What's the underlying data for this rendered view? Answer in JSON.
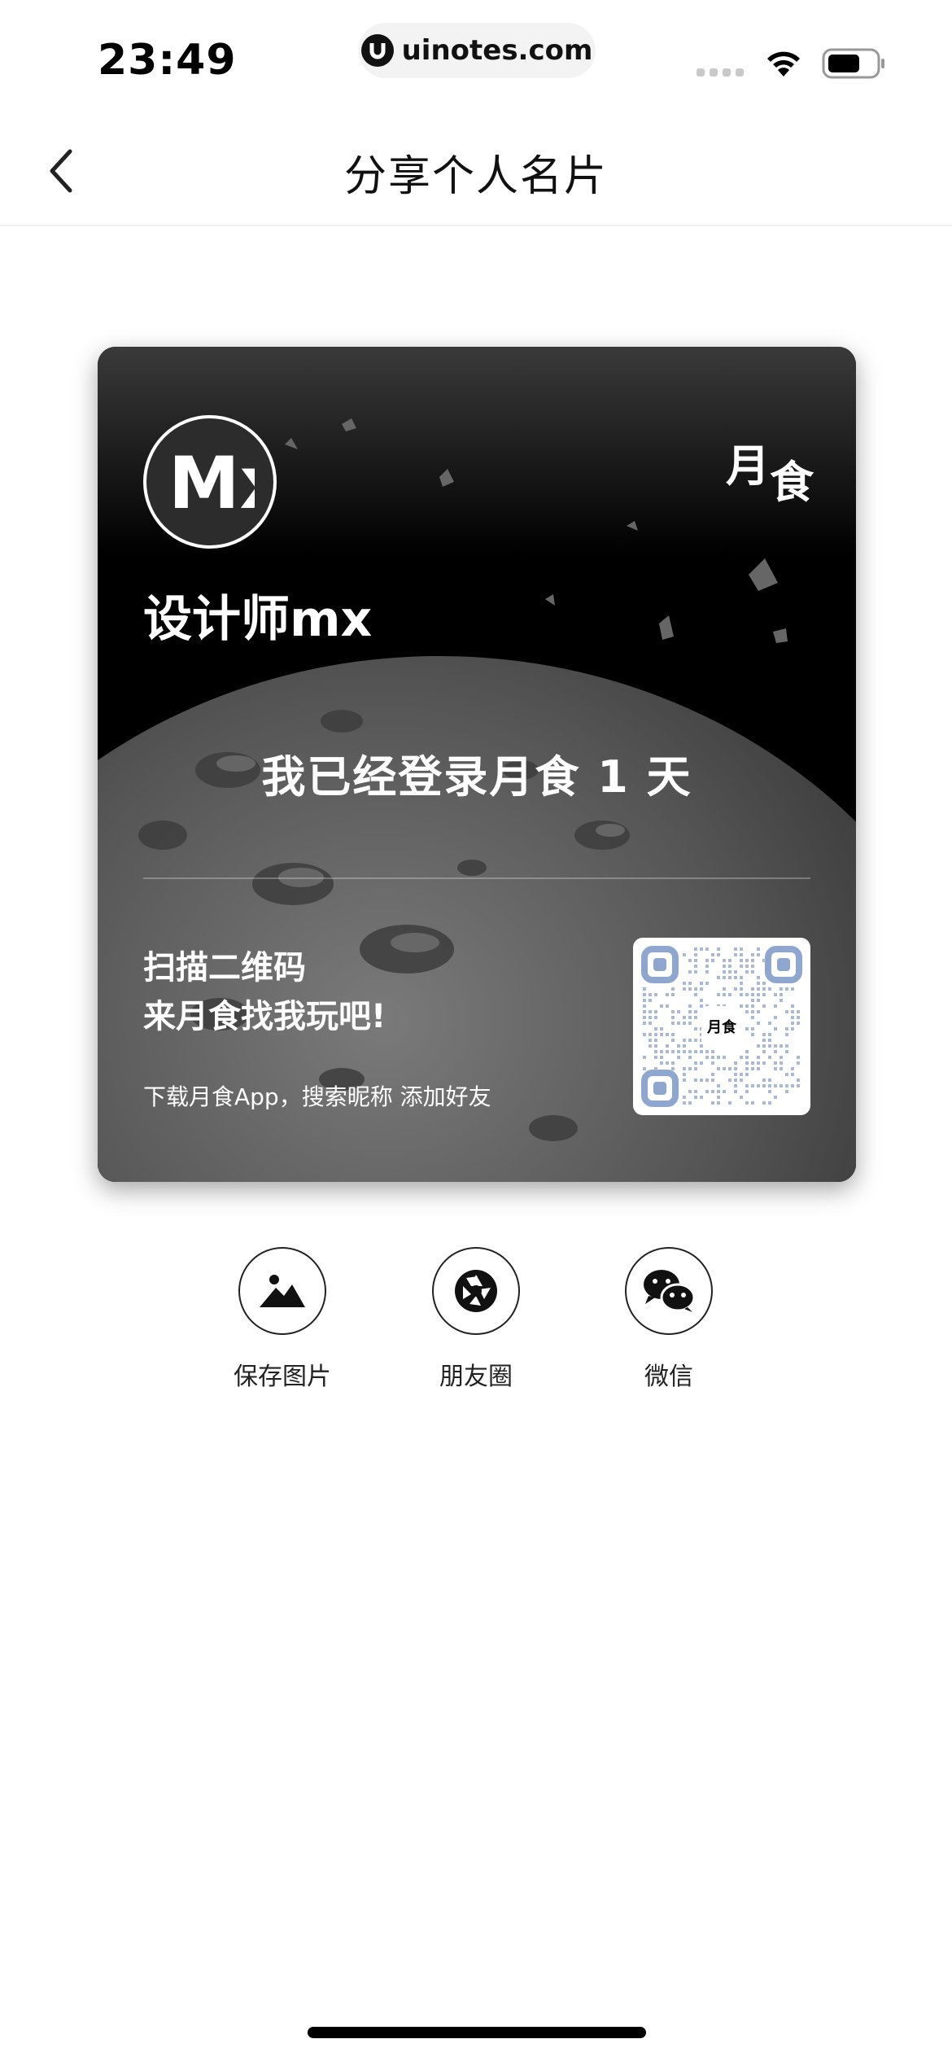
{
  "status_bar": {
    "time": "23:49",
    "url": "uinotes.com"
  },
  "nav": {
    "title": "分享个人名片"
  },
  "card": {
    "avatar_text": "Mx",
    "brand_logo_chars": [
      "月",
      "食"
    ],
    "username": "设计师mx",
    "login_days_text": "我已经登录月食 1 天",
    "scan_line1": "扫描二维码",
    "scan_line2": "来月食找我玩吧!",
    "tip": "下载月食App，搜索昵称 添加好友",
    "qr_center_text": "月食"
  },
  "share": [
    {
      "label": "保存图片",
      "icon": "image-icon"
    },
    {
      "label": "朋友圈",
      "icon": "moments-icon"
    },
    {
      "label": "微信",
      "icon": "wechat-icon"
    }
  ],
  "colors": {
    "card_bg": "#000000",
    "qr_accent": "#8fa6cf",
    "text_dark": "#111111"
  }
}
